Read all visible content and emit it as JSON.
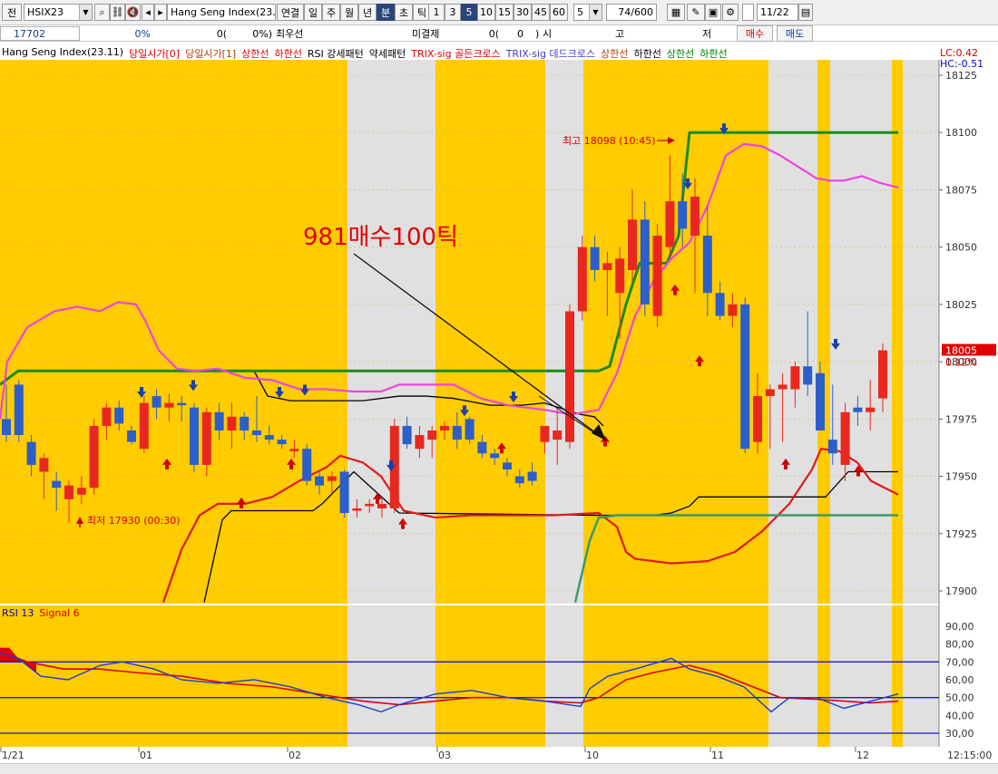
{
  "toolbar": {
    "tab_label": "전",
    "symbol": "HSIX23",
    "search_field": "",
    "name": "Hang Seng Index(23.1",
    "period_buttons": [
      "연결",
      "일",
      "주",
      "월",
      "년",
      "분",
      "초",
      "틱"
    ],
    "interval_buttons": [
      "1",
      "3",
      "5",
      "10",
      "15",
      "30",
      "45",
      "60"
    ],
    "interval_value": "5",
    "count_value": "74/600",
    "date_value": "11/22"
  },
  "infobar": {
    "price": "17702",
    "change_pct": "0%",
    "volume_label": "0(",
    "volume_pct": "0%)",
    "best_label": "최우선",
    "unfilled_label": "미결제",
    "unfilled_value": "0(",
    "unfilled_paren": "0",
    "unfilled_close": ")",
    "market_label": "시",
    "market_value": "고",
    "low_label": "저",
    "buy_label": "매수",
    "sell_label": "매도"
  },
  "legend": [
    {
      "text": "Hang Seng Index(23.11)",
      "color": "#000000"
    },
    {
      "text": "당일시가[0]",
      "color": "#e00000"
    },
    {
      "text": "당일시가[1]",
      "color": "#b04000"
    },
    {
      "text": "상한선",
      "color": "#e00000"
    },
    {
      "text": "하한선",
      "color": "#e00000"
    },
    {
      "text": "RSI 강세패턴",
      "color": "#000000"
    },
    {
      "text": "약세패턴",
      "color": "#000000"
    },
    {
      "text": "TRIX-sig 골든크로스",
      "color": "#e00000"
    },
    {
      "text": "TRIX-sig 데드크로스",
      "color": "#4040c0"
    },
    {
      "text": "상한선",
      "color": "#b04000"
    },
    {
      "text": "하한선",
      "color": "#000000"
    },
    {
      "text": "상한선",
      "color": "#008000"
    },
    {
      "text": "하한선",
      "color": "#008000"
    }
  ],
  "right_labels": {
    "lc": "LC:0.42",
    "hc": "HC:-0.51",
    "current_price": "18005",
    "current_pct": "0.12%"
  },
  "annotations": {
    "note": "981매수100틱",
    "high_label": "최고 18098 (10:45)",
    "low_label": "최저 17930 (00:30)"
  },
  "rsi_legend": {
    "rsi": "RSI 13",
    "signal": "Signal 6"
  },
  "colors": {
    "gold": "#ffcc00",
    "gray": "#e0e0e0",
    "up": "#e8281e",
    "down": "#2d5fc8",
    "pink": "#ee44dd",
    "green": "#1a8c1a",
    "teal": "#3c9a6a",
    "redline": "#e01a1a"
  },
  "chart_data": {
    "type": "candlestick",
    "yticks": [
      "18125",
      "18100",
      "18075",
      "18050",
      "18025",
      "18000",
      "17975",
      "17950",
      "17925",
      "17900"
    ],
    "ylim": [
      17895,
      18130
    ],
    "x_labels": [
      "1/21",
      "01",
      "02",
      "03",
      "10",
      "11",
      "12",
      "12:15:00"
    ],
    "rsi_ticks": [
      "90,00",
      "80,00",
      "70,00",
      "60,00",
      "50,00",
      "40,00",
      "30,00"
    ],
    "rsi_ylim": [
      25,
      95
    ],
    "rsi_levels": [
      70,
      50,
      30
    ],
    "candles": [
      [
        17975,
        17990,
        17965,
        17968
      ],
      [
        17990,
        17992,
        17965,
        17968
      ],
      [
        17965,
        17968,
        17950,
        17955
      ],
      [
        17952,
        17960,
        17940,
        17958
      ],
      [
        17948,
        17952,
        17935,
        17945
      ],
      [
        17940,
        17948,
        17930,
        17946
      ],
      [
        17942,
        17950,
        17938,
        17945
      ],
      [
        17945,
        17975,
        17942,
        17972
      ],
      [
        17972,
        17982,
        17966,
        17980
      ],
      [
        17980,
        17983,
        17970,
        17973
      ],
      [
        17970,
        17972,
        17964,
        17965
      ],
      [
        17962,
        17985,
        17960,
        17982
      ],
      [
        17985,
        17988,
        17975,
        17980
      ],
      [
        17980,
        17986,
        17974,
        17982
      ],
      [
        17982,
        17985,
        17974,
        17981
      ],
      [
        17980,
        17982,
        17952,
        17955
      ],
      [
        17955,
        17980,
        17950,
        17978
      ],
      [
        17978,
        17982,
        17966,
        17970
      ],
      [
        17970,
        17982,
        17962,
        17976
      ],
      [
        17976,
        17978,
        17966,
        17970
      ],
      [
        17970,
        17985,
        17965,
        17968
      ],
      [
        17968,
        17972,
        17964,
        17966
      ],
      [
        17966,
        17968,
        17962,
        17964
      ],
      [
        17961,
        17966,
        17958,
        17962
      ],
      [
        17962,
        17964,
        17946,
        17948
      ],
      [
        17950,
        17952,
        17942,
        17946
      ],
      [
        17948,
        17952,
        17943,
        17950
      ],
      [
        17952,
        17953,
        17932,
        17934
      ],
      [
        17935,
        17940,
        17932,
        17936
      ],
      [
        17937,
        17940,
        17934,
        17938
      ],
      [
        17936,
        17940,
        17932,
        17938
      ],
      [
        17936,
        17975,
        17934,
        17972
      ],
      [
        17972,
        17976,
        17962,
        17964
      ],
      [
        17962,
        17972,
        17958,
        17968
      ],
      [
        17966,
        17972,
        17958,
        17970
      ],
      [
        17970,
        17974,
        17966,
        17972
      ],
      [
        17972,
        17978,
        17962,
        17966
      ],
      [
        17975,
        17976,
        17964,
        17966
      ],
      [
        17965,
        17968,
        17958,
        17960
      ],
      [
        17960,
        17962,
        17955,
        17958
      ],
      [
        17956,
        17958,
        17950,
        17953
      ],
      [
        17950,
        17953,
        17945,
        17947
      ],
      [
        17952,
        17956,
        17946,
        17948
      ],
      [
        17965,
        17970,
        17960,
        17972
      ],
      [
        17966,
        17980,
        17955,
        17970
      ],
      [
        17965,
        18025,
        17962,
        18022
      ],
      [
        18022,
        18055,
        18018,
        18050
      ],
      [
        18050,
        18055,
        18035,
        18040
      ],
      [
        18040,
        18048,
        18020,
        18043
      ],
      [
        18030,
        18050,
        18010,
        18045
      ],
      [
        18040,
        18075,
        18035,
        18062
      ],
      [
        18062,
        18070,
        18020,
        18025
      ],
      [
        18020,
        18060,
        18015,
        18055
      ],
      [
        18050,
        18090,
        18045,
        18070
      ],
      [
        18070,
        18082,
        18050,
        18058
      ],
      [
        18055,
        18080,
        18030,
        18072
      ],
      [
        18055,
        18068,
        18020,
        18030
      ],
      [
        18030,
        18035,
        18018,
        18020
      ],
      [
        18020,
        18030,
        18015,
        18025
      ],
      [
        18025,
        18028,
        17960,
        17962
      ],
      [
        17965,
        17995,
        17960,
        17985
      ],
      [
        17985,
        17990,
        17962,
        17988
      ],
      [
        17988,
        17995,
        17965,
        17990
      ],
      [
        17988,
        18000,
        17980,
        17998
      ],
      [
        17998,
        18022,
        17985,
        17990
      ],
      [
        17995,
        18000,
        17975,
        17970
      ],
      [
        17966,
        17990,
        17955,
        17960
      ],
      [
        17955,
        17982,
        17948,
        17978
      ],
      [
        17980,
        17985,
        17972,
        17978
      ],
      [
        17978,
        17992,
        17970,
        17980
      ],
      [
        17984,
        18008,
        17978,
        18005
      ]
    ],
    "pink": [
      [
        0,
        17975
      ],
      [
        8,
        18000
      ],
      [
        30,
        18015
      ],
      [
        60,
        18022
      ],
      [
        85,
        18024
      ],
      [
        110,
        18022
      ],
      [
        130,
        18026
      ],
      [
        150,
        18025
      ],
      [
        160,
        18018
      ],
      [
        175,
        18005
      ],
      [
        195,
        17997
      ],
      [
        215,
        17996
      ],
      [
        240,
        17997
      ],
      [
        270,
        17993
      ],
      [
        300,
        17992
      ],
      [
        330,
        17988
      ],
      [
        360,
        17988
      ],
      [
        390,
        17987
      ],
      [
        420,
        17987
      ],
      [
        440,
        17990
      ],
      [
        470,
        17990
      ],
      [
        500,
        17990
      ],
      [
        530,
        17984
      ],
      [
        560,
        17981
      ],
      [
        600,
        17979
      ],
      [
        630,
        17977
      ],
      [
        660,
        17979
      ],
      [
        680,
        17995
      ],
      [
        700,
        18020
      ],
      [
        720,
        18035
      ],
      [
        740,
        18045
      ],
      [
        760,
        18052
      ],
      [
        780,
        18068
      ],
      [
        800,
        18090
      ],
      [
        820,
        18095
      ],
      [
        840,
        18094
      ],
      [
        860,
        18090
      ],
      [
        880,
        18085
      ],
      [
        900,
        18080
      ],
      [
        915,
        18079
      ],
      [
        930,
        18079
      ],
      [
        950,
        18081
      ],
      [
        970,
        18078
      ],
      [
        990,
        18076
      ]
    ],
    "green": [
      [
        0,
        17990
      ],
      [
        20,
        17996
      ],
      [
        40,
        17996
      ],
      [
        200,
        17996
      ],
      [
        400,
        17996
      ],
      [
        600,
        17996
      ],
      [
        660,
        17996
      ],
      [
        672,
        17998
      ],
      [
        690,
        18025
      ],
      [
        705,
        18043
      ],
      [
        735,
        18043
      ],
      [
        748,
        18055
      ],
      [
        760,
        18100
      ],
      [
        990,
        18100
      ]
    ],
    "black_upper": [
      [
        280,
        17996
      ],
      [
        295,
        17985
      ],
      [
        320,
        17983
      ],
      [
        400,
        17983
      ],
      [
        440,
        17985
      ],
      [
        470,
        17985
      ],
      [
        500,
        17984
      ],
      [
        540,
        17981
      ],
      [
        575,
        17981
      ],
      [
        600,
        17982
      ],
      [
        640,
        17977
      ],
      [
        655,
        17976
      ],
      [
        665,
        17972
      ]
    ],
    "black_lower": [
      [
        225,
        17895
      ],
      [
        245,
        17931
      ],
      [
        255,
        17935
      ],
      [
        345,
        17935
      ],
      [
        355,
        17938
      ],
      [
        390,
        17952
      ],
      [
        440,
        17934
      ],
      [
        660,
        17933
      ],
      [
        720,
        17933
      ],
      [
        740,
        17934
      ],
      [
        760,
        17937
      ],
      [
        770,
        17941
      ],
      [
        910,
        17941
      ],
      [
        935,
        17952
      ],
      [
        990,
        17952
      ]
    ],
    "red_lower": [
      [
        180,
        17895
      ],
      [
        200,
        17918
      ],
      [
        220,
        17933
      ],
      [
        240,
        17938
      ],
      [
        270,
        17938
      ],
      [
        300,
        17941
      ],
      [
        330,
        17948
      ],
      [
        360,
        17954
      ],
      [
        375,
        17959
      ],
      [
        400,
        17956
      ],
      [
        420,
        17950
      ],
      [
        445,
        17935
      ],
      [
        480,
        17932
      ],
      [
        520,
        17933
      ],
      [
        560,
        17933
      ],
      [
        610,
        17933
      ],
      [
        660,
        17934
      ],
      [
        680,
        17928
      ],
      [
        690,
        17917
      ],
      [
        700,
        17914
      ],
      [
        740,
        17912
      ],
      [
        780,
        17913
      ],
      [
        810,
        17917
      ],
      [
        840,
        17926
      ],
      [
        870,
        17938
      ],
      [
        895,
        17953
      ],
      [
        905,
        17962
      ],
      [
        925,
        17961
      ],
      [
        945,
        17956
      ],
      [
        960,
        17948
      ],
      [
        980,
        17944
      ],
      [
        990,
        17942
      ]
    ],
    "teal": [
      [
        634,
        17895
      ],
      [
        650,
        17922
      ],
      [
        660,
        17932
      ],
      [
        680,
        17933
      ],
      [
        720,
        17933
      ],
      [
        780,
        17933
      ],
      [
        990,
        17933
      ]
    ],
    "rsi": [
      [
        0,
        75
      ],
      [
        20,
        72
      ],
      [
        45,
        62
      ],
      [
        75,
        60
      ],
      [
        110,
        68
      ],
      [
        135,
        70
      ],
      [
        170,
        66
      ],
      [
        200,
        60
      ],
      [
        240,
        58
      ],
      [
        280,
        60
      ],
      [
        320,
        56
      ],
      [
        360,
        50
      ],
      [
        395,
        46
      ],
      [
        420,
        42
      ],
      [
        440,
        46
      ],
      [
        480,
        52
      ],
      [
        520,
        54
      ],
      [
        560,
        50
      ],
      [
        600,
        48
      ],
      [
        640,
        45
      ],
      [
        650,
        55
      ],
      [
        670,
        62
      ],
      [
        700,
        66
      ],
      [
        740,
        72
      ],
      [
        760,
        66
      ],
      [
        790,
        62
      ],
      [
        820,
        56
      ],
      [
        850,
        42
      ],
      [
        870,
        50
      ],
      [
        900,
        50
      ],
      [
        930,
        44
      ],
      [
        960,
        48
      ],
      [
        990,
        52
      ]
    ],
    "signal": [
      [
        0,
        76
      ],
      [
        30,
        70
      ],
      [
        70,
        66
      ],
      [
        110,
        66
      ],
      [
        150,
        64
      ],
      [
        200,
        62
      ],
      [
        250,
        58
      ],
      [
        300,
        56
      ],
      [
        350,
        52
      ],
      [
        400,
        48
      ],
      [
        440,
        46
      ],
      [
        480,
        48
      ],
      [
        520,
        50
      ],
      [
        560,
        50
      ],
      [
        600,
        48
      ],
      [
        640,
        47
      ],
      [
        660,
        50
      ],
      [
        690,
        60
      ],
      [
        720,
        64
      ],
      [
        760,
        68
      ],
      [
        790,
        64
      ],
      [
        830,
        56
      ],
      [
        860,
        50
      ],
      [
        900,
        49
      ],
      [
        930,
        48
      ],
      [
        960,
        47
      ],
      [
        990,
        48
      ]
    ],
    "buy_arrows": [
      [
        184,
        17955
      ],
      [
        266,
        17938
      ],
      [
        321,
        17955
      ],
      [
        416,
        17940
      ],
      [
        444,
        17929
      ],
      [
        553,
        17962
      ],
      [
        667,
        17965
      ],
      [
        744,
        18031
      ],
      [
        771,
        18000
      ],
      [
        866,
        17955
      ],
      [
        946,
        17952
      ]
    ],
    "sell_arrows": [
      [
        156,
        17987
      ],
      [
        213,
        17990
      ],
      [
        308,
        17987
      ],
      [
        336,
        17988
      ],
      [
        431,
        17955
      ],
      [
        512,
        17979
      ],
      [
        566,
        17985
      ],
      [
        758,
        18078
      ],
      [
        798,
        18102
      ],
      [
        921,
        18008
      ]
    ]
  }
}
